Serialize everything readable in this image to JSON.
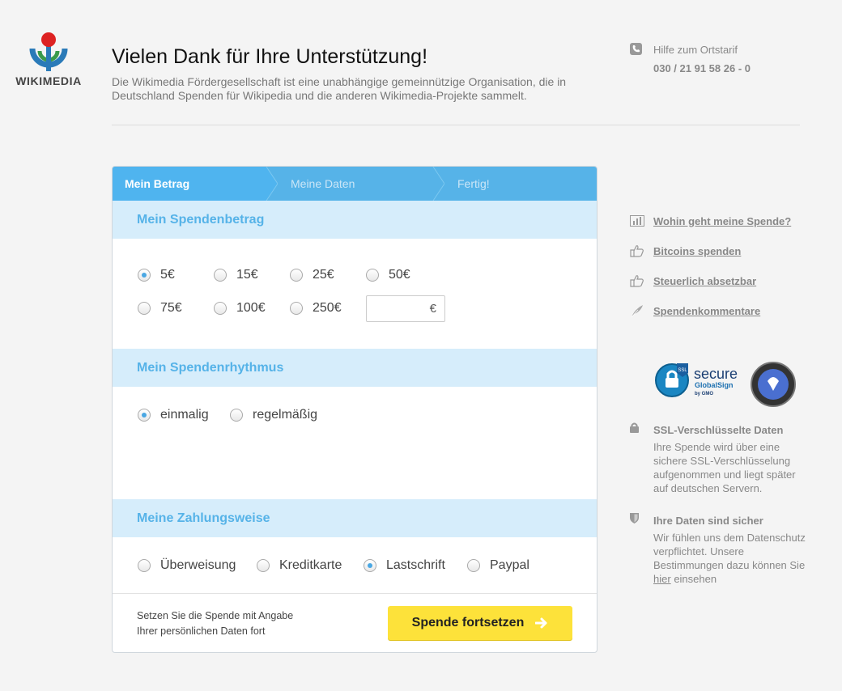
{
  "logo": {
    "text": "WIKIMEDIA"
  },
  "header": {
    "title": "Vielen Dank für Ihre Unterstützung!",
    "intro": "Die Wikimedia Fördergesellschaft ist eine unabhängige gemeinnützige Organisation, die in Deutschland Spenden für Wikipedia und die anderen Wikimedia-Projekte sammelt."
  },
  "hotline": {
    "label": "Hilfe zum Ortstarif",
    "number": "030 / 21 91 58 26 - 0"
  },
  "steps": [
    {
      "label": "Mein Betrag",
      "active": true
    },
    {
      "label": "Meine Daten",
      "active": false
    },
    {
      "label": "Fertig!",
      "active": false
    }
  ],
  "amount_section": {
    "title": "Mein Spendenbetrag",
    "options": [
      "5€",
      "15€",
      "25€",
      "50€",
      "75€",
      "100€",
      "250€"
    ],
    "selected": "5€",
    "custom_currency": "€"
  },
  "rhythm_section": {
    "title": "Mein Spendenrhythmus",
    "options": [
      "einmalig",
      "regelmäßig"
    ],
    "selected": "einmalig"
  },
  "payment_section": {
    "title": "Meine Zahlungsweise",
    "options": [
      "Überweisung",
      "Kreditkarte",
      "Lastschrift",
      "Paypal"
    ],
    "selected": "Lastschrift"
  },
  "footer": {
    "line1": "Setzen Sie die Spende mit Angabe",
    "line2": "Ihrer persönlichen Daten fort",
    "cta": "Spende fortsetzen"
  },
  "sidebar": {
    "links": [
      {
        "label": "Wohin geht meine Spende?",
        "icon": "chart-icon"
      },
      {
        "label": "Bitcoins spenden",
        "icon": "thumbs-up-icon"
      },
      {
        "label": "Steuerlich absetzbar",
        "icon": "thumbs-up-icon"
      },
      {
        "label": "Spendenkommentare",
        "icon": "feather-icon"
      }
    ],
    "ssl_badge": {
      "ssl": "SSL",
      "secure": "secure",
      "globalsign": "GlobalSign",
      "gmo": "by GMO"
    },
    "ssl_title": "SSL-Verschlüsselte Daten",
    "ssl_text": "Ihre Spende wird über eine sichere SSL-Verschlüsselung aufgenommen und liegt später auf deutschen Servern.",
    "safe_title": "Ihre Daten sind sicher",
    "safe_text": "Wir fühlen uns dem Datenschutz verpflichtet. Unsere Bestimmungen dazu können Sie",
    "safe_link": "hier",
    "safe_after": "einsehen"
  },
  "colors": {
    "accent": "#56b3e8",
    "section_bg": "#d6edfb",
    "cta": "#fde23a"
  }
}
